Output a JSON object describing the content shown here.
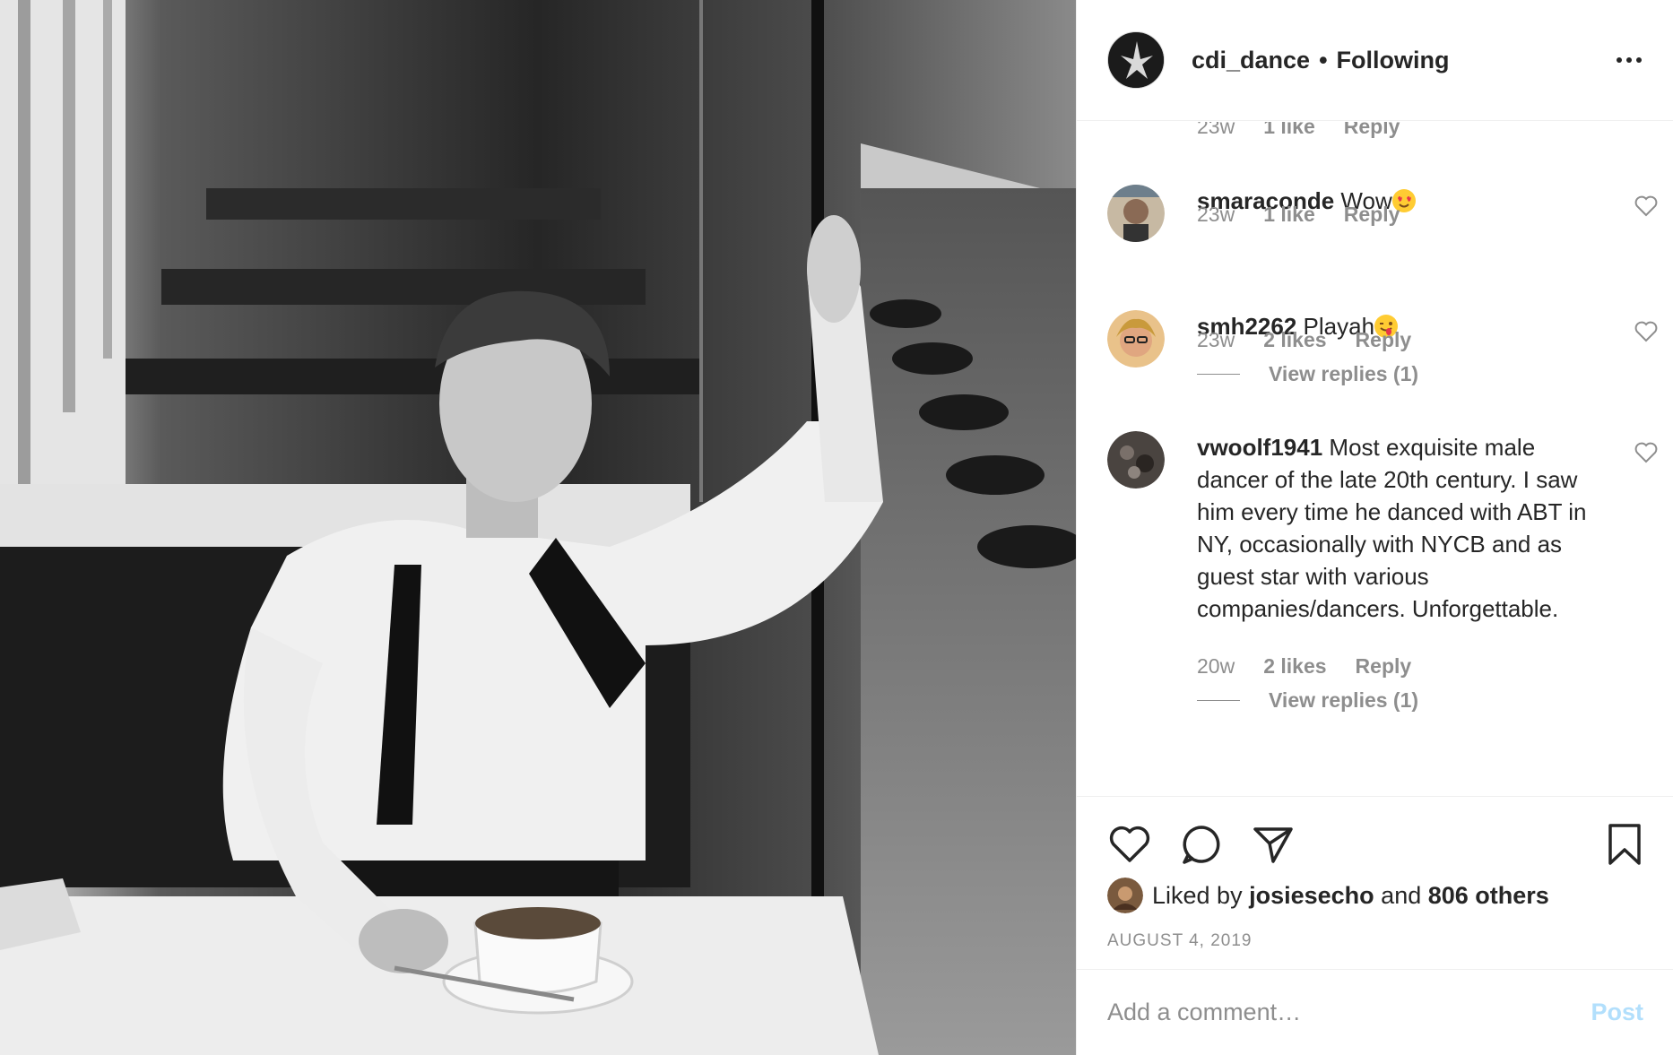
{
  "post": {
    "username": "cdi_dance",
    "separator": "•",
    "follow_status": "Following",
    "more_icon": "more-horizontal-icon"
  },
  "comments": {
    "partial_top": {
      "time": "23w",
      "likes": "1 like",
      "reply": "Reply"
    },
    "items": [
      {
        "user": "smaraconde",
        "text": "Wow",
        "emoji": "heart-eyes-emoji",
        "time": "23w",
        "likes": "1 like",
        "reply": "Reply",
        "view_replies": ""
      },
      {
        "user": "smh2262",
        "text": "Playah",
        "emoji": "winking-tongue-emoji",
        "time": "23w",
        "likes": "2 likes",
        "reply": "Reply",
        "view_replies": "View replies (1)"
      },
      {
        "user": "vwoolf1941",
        "text": "Most exquisite male dancer of the late 20th century. I saw him every time he danced with ABT in NY, occasionally with NYCB and as guest star with various companies/dancers. Unforgettable.",
        "emoji": "",
        "time": "20w",
        "likes": "2 likes",
        "reply": "Reply",
        "view_replies": "View replies (1)"
      }
    ]
  },
  "actions": {
    "like_icon": "heart-icon",
    "comment_icon": "comment-icon",
    "share_icon": "paper-plane-icon",
    "save_icon": "bookmark-icon"
  },
  "likes": {
    "prefix": "Liked by",
    "user": "josiesecho",
    "conjunction": "and",
    "others": "806 others"
  },
  "date": "AUGUST 4, 2019",
  "add_comment": {
    "placeholder": "Add a comment…",
    "post_label": "Post"
  },
  "colors": {
    "text": "#262626",
    "muted": "#8e8e8e",
    "border": "#efefef",
    "post_disabled": "#b2dffc"
  }
}
